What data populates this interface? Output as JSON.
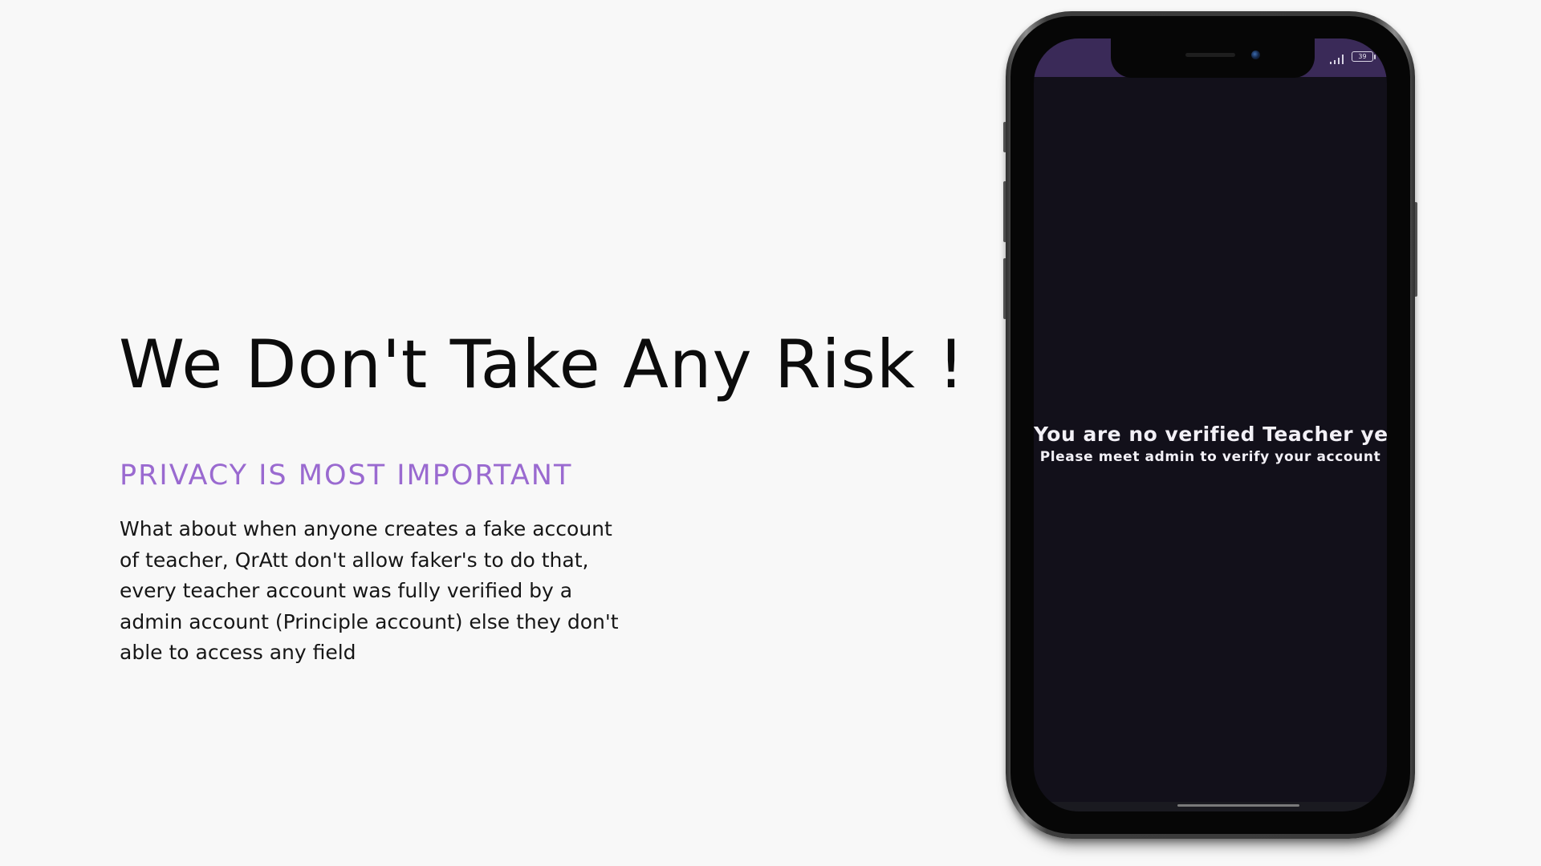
{
  "hero": {
    "title": "We Don't Take Any Risk !",
    "subtitle": "PRIVACY IS MOST IMPORTANT",
    "body": "What about when anyone creates a fake account of teacher, QrAtt don't allow faker's to do that, every teacher account was fully verified by a admin account (Principle account) else they don't able to access any field"
  },
  "phone": {
    "status_bar": {
      "battery_level": "39",
      "signal_icon": "signal-icon",
      "battery_icon": "battery-icon"
    },
    "message": {
      "title": "You are no verified Teacher yet",
      "subtitle": "Please meet admin to verify your account"
    }
  },
  "colors": {
    "background": "#f8f8f8",
    "title": "#0c0c0c",
    "subtitle_accent": "#9a6ad0",
    "body_text": "#161616",
    "screen_background": "#12101a",
    "status_strip": "#3a2a58",
    "message_text": "#f2f0f6"
  }
}
